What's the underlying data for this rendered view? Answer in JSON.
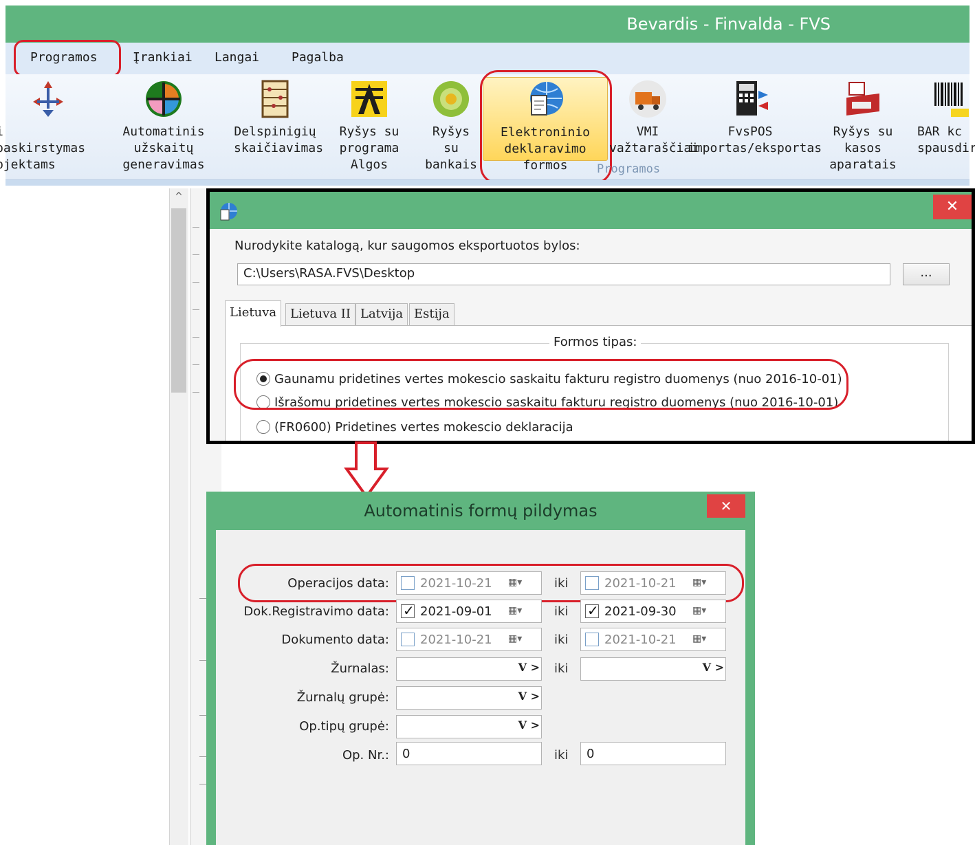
{
  "app": {
    "title": "Bevardis - Finvalda - FVS"
  },
  "menu": [
    "Programos",
    "Įrankiai",
    "Langai",
    "Pagalba"
  ],
  "ribbon": {
    "group_label": "Programos",
    "buttons": [
      {
        "label": "i paskirstymas\nbjektams",
        "icon": "distribution-icon"
      },
      {
        "label": "Automatinis užskaitų\ngeneravimas",
        "icon": "globe-grid-icon"
      },
      {
        "label": "Delspinigių\nskaičiavimas",
        "icon": "abacus-icon"
      },
      {
        "label": "Ryšys su\nprograma Algos",
        "icon": "algos-icon"
      },
      {
        "label": "Ryšys su\nbankais",
        "icon": "bank-icon"
      },
      {
        "label": "Elektroninio\ndeklaravimo formos",
        "icon": "e-declaration-icon"
      },
      {
        "label": "VMI\nvažtaraščiai",
        "icon": "truck-icon"
      },
      {
        "label": "FvsPOS\nimportas/eksportas",
        "icon": "pos-icon"
      },
      {
        "label": "Ryšys su kasos\naparatais",
        "icon": "cash-register-icon"
      },
      {
        "label": "BAR kc\nspausdir",
        "icon": "barcode-icon"
      }
    ]
  },
  "export_dialog": {
    "close": "✕",
    "prompt": "Nurodykite katalogą, kur saugomos eksportuotos bylos:",
    "path": "C:\\Users\\RASA.FVS\\Desktop",
    "browse": "...",
    "tabs": [
      "Lietuva",
      "Lietuva II",
      "Latvija",
      "Estija"
    ],
    "group_title": "Formos tipas:",
    "options": [
      {
        "label": "Gaunamu pridetines vertes mokescio saskaitu fakturu registro duomenys (nuo 2016-10-01)",
        "selected": true
      },
      {
        "label": "Išrašomu pridetines vertes mokescio saskaitu fakturu registro duomenys (nuo 2016-10-01)",
        "selected": false
      },
      {
        "label": "(FR0600) Pridetines vertes mokescio deklaracija",
        "selected": false
      }
    ]
  },
  "auto_dialog": {
    "title": "Automatinis formų pildymas",
    "close": "✕",
    "iki": "iki",
    "rows": {
      "operacijos": {
        "label": "Operacijos data:",
        "from": "2021-10-21",
        "to": "2021-10-21",
        "from_checked": false,
        "to_checked": false
      },
      "registravimo": {
        "label": "Dok.Registravimo data:",
        "from": "2021-09-01",
        "to": "2021-09-30",
        "from_checked": true,
        "to_checked": true
      },
      "dokumento": {
        "label": "Dokumento data:",
        "from": "2021-10-21",
        "to": "2021-10-21",
        "from_checked": false,
        "to_checked": false
      },
      "zurnalas": {
        "label": "Žurnalas:"
      },
      "zurnalu_grupe": {
        "label": "Žurnalų grupė:"
      },
      "op_tipu_grupe": {
        "label": "Op.tipų grupė:"
      },
      "op_nr": {
        "label": "Op. Nr.:",
        "from": "0",
        "to": "0"
      }
    },
    "combo_buttons": "V >"
  },
  "colors": {
    "titlebar": "#5fb57f",
    "highlight": "#d81f2a",
    "close": "#e04343"
  }
}
